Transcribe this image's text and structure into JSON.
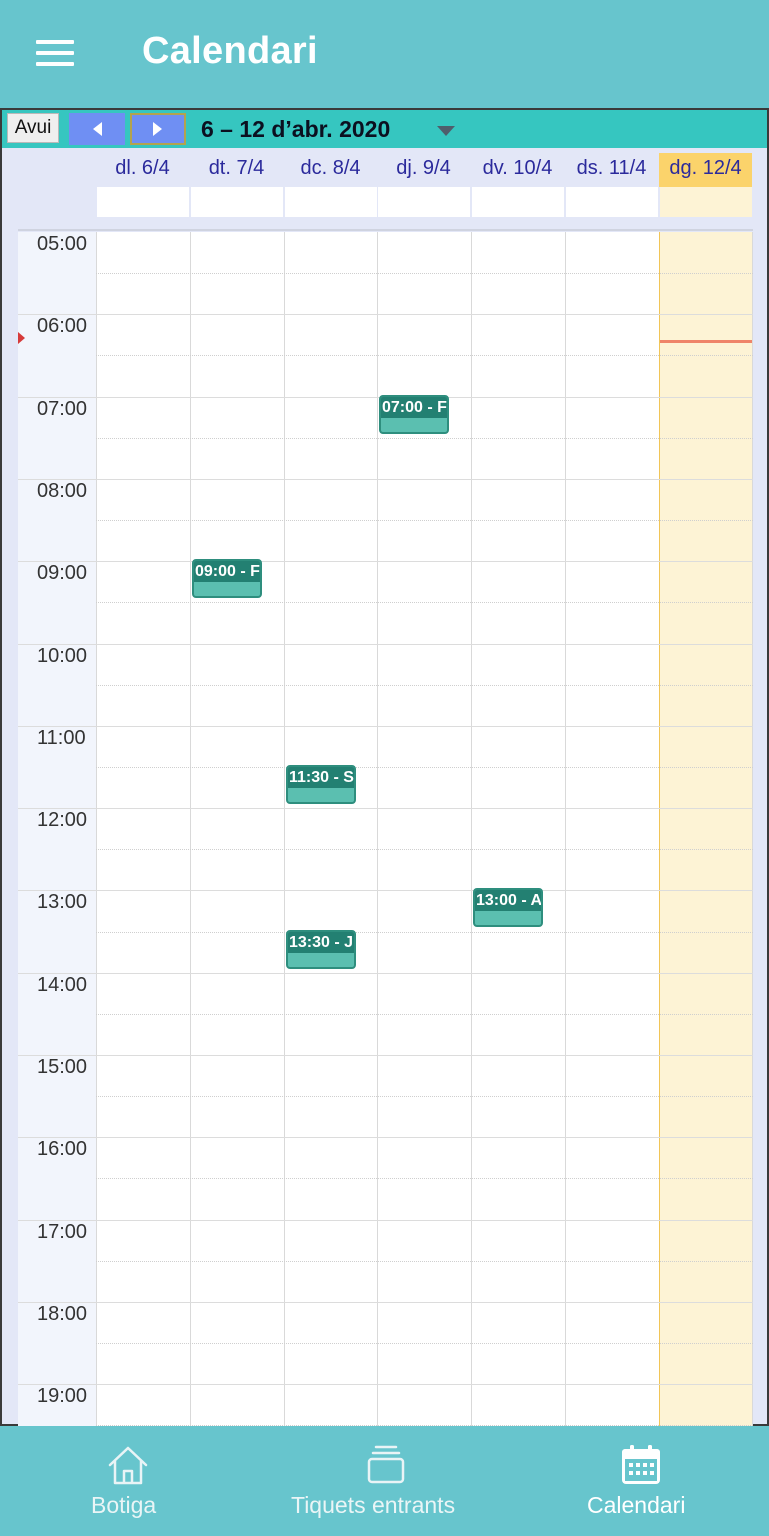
{
  "appbar": {
    "title": "Calendari",
    "menu_icon": "menu-icon"
  },
  "toolbar": {
    "today_label": "Avui",
    "range_label": "6 – 12 d’abr. 2020",
    "prev_icon": "chevron-left-icon",
    "next_icon": "chevron-right-icon",
    "dropdown_icon": "caret-down-icon"
  },
  "days": [
    {
      "label": "dl. 6/4"
    },
    {
      "label": "dt. 7/4"
    },
    {
      "label": "dc. 8/4"
    },
    {
      "label": "dj. 9/4"
    },
    {
      "label": "dv. 10/4"
    },
    {
      "label": "ds. 11/4"
    },
    {
      "label": "dg. 12/4",
      "today": true
    }
  ],
  "hours": [
    "05:00",
    "06:00",
    "07:00",
    "08:00",
    "09:00",
    "10:00",
    "11:00",
    "12:00",
    "13:00",
    "14:00",
    "15:00",
    "16:00",
    "17:00",
    "18:00",
    "19:00"
  ],
  "events": [
    {
      "label": "07:00 - F",
      "day": "dj. 9/4",
      "start": "07:00"
    },
    {
      "label": "09:00 - F",
      "day": "dt. 7/4",
      "start": "09:00"
    },
    {
      "label": "11:30 - S",
      "day": "dc. 8/4",
      "start": "11:30"
    },
    {
      "label": "13:00 - A",
      "day": "dv. 10/4",
      "start": "13:00"
    },
    {
      "label": "13:30 - J",
      "day": "dc. 8/4",
      "start": "13:30"
    }
  ],
  "bottom_nav": [
    {
      "label": "Botiga",
      "icon": "home-icon",
      "active": false
    },
    {
      "label": "Tiquets entrants",
      "icon": "inbox-icon",
      "active": false
    },
    {
      "label": "Calendari",
      "icon": "calendar-icon",
      "active": true
    }
  ],
  "colors": {
    "primary": "#67c5cd",
    "toolbar": "#36c6c0",
    "today_header": "#fbd36b",
    "today_column": "#fdf3d5",
    "event": "#5bbfb0",
    "event_header": "#238072",
    "now_line": "#ef8469"
  }
}
